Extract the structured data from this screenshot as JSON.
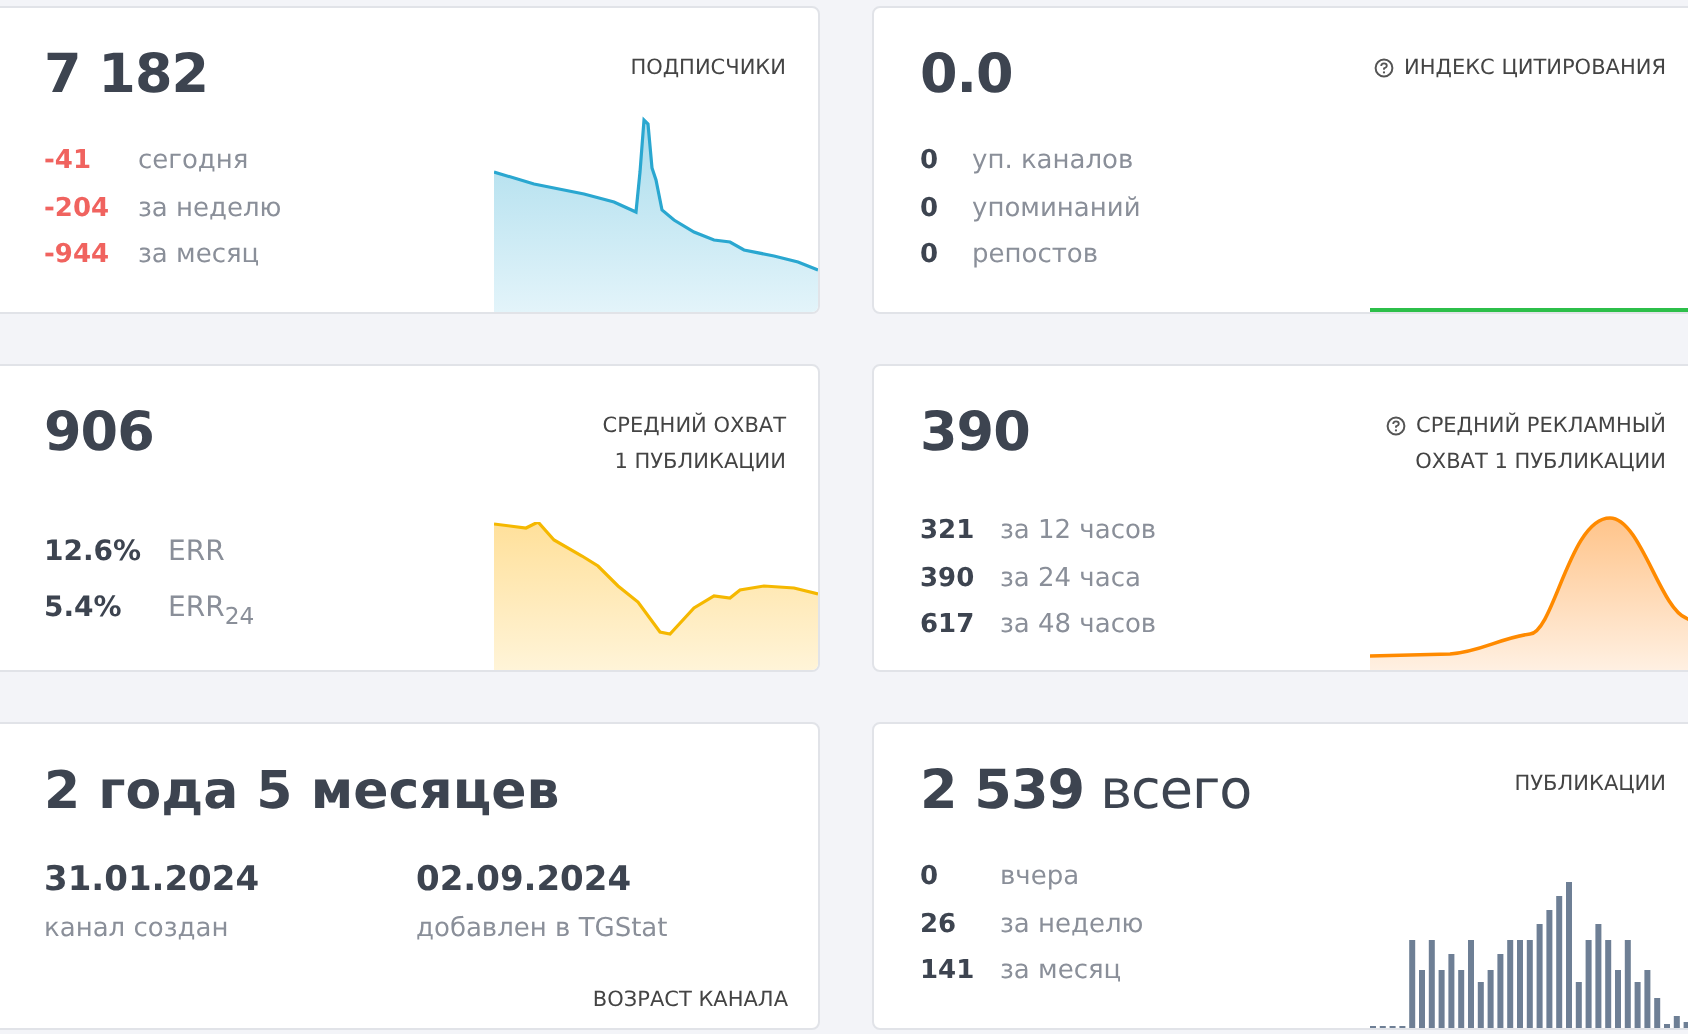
{
  "cards": [
    {
      "kind": "stats",
      "graph": {
        "kind": "subscribers"
      },
      "value": "7 182",
      "title": "ПОДПИСЧИКИ",
      "help": false,
      "stats": [
        {
          "value": "-41",
          "label": "сегодня",
          "negative": true
        },
        {
          "value": "-204",
          "label": "за неделю",
          "negative": true
        },
        {
          "value": "-944",
          "label": "за месяц",
          "negative": true
        }
      ]
    },
    {
      "kind": "stats",
      "graph": {
        "kind": "citation"
      },
      "value": "0.0",
      "title": "ИНДЕКС ЦИТИРОВАНИЯ",
      "help": true,
      "stats": [
        {
          "value": "0",
          "label": "уп. каналов",
          "negative": false
        },
        {
          "value": "0",
          "label": "упоминаний",
          "negative": false
        },
        {
          "value": "0",
          "label": "репостов",
          "negative": false
        }
      ]
    },
    {
      "kind": "stats",
      "graph": {
        "kind": "reach"
      },
      "value": "906",
      "title": "СРЕДНИЙ ОХВАТ\n1 ПУБЛИКАЦИИ",
      "help": false,
      "stats": [
        {
          "value": "12.6%",
          "label": "ERR",
          "negative": false
        },
        {
          "value": "5.4%",
          "label": "ERR$_{24}$",
          "negative": false
        }
      ]
    },
    {
      "kind": "stats",
      "graph": {
        "kind": "ad_reach"
      },
      "value": "390",
      "title": "СРЕДНИЙ РЕКЛАМНЫЙ\nОХВАТ 1 ПУБЛИКАЦИИ",
      "help": true,
      "stats": [
        {
          "value": "321",
          "label": "за 12 часов",
          "negative": false
        },
        {
          "value": "390",
          "label": "за 24 часа",
          "negative": false
        },
        {
          "value": "617",
          "label": "за 48 часов",
          "negative": false
        }
      ]
    },
    {
      "kind": "age",
      "value": "2 года 5 месяцев",
      "title": "ВОЗРАСТ КАНАЛА",
      "dates": [
        {
          "date": "31.01.2024",
          "label": "канал создан"
        },
        {
          "date": "02.09.2024",
          "label": "добавлен в TGStat"
        }
      ]
    },
    {
      "kind": "stats",
      "graph": {
        "kind": "posts"
      },
      "value": "**2 539** всего",
      "title": "ПУБЛИКАЦИИ",
      "help": false,
      "stats": [
        {
          "value": "0",
          "label": "вчера",
          "negative": false
        },
        {
          "value": "26",
          "label": "за неделю",
          "negative": false
        },
        {
          "value": "141",
          "label": "за месяц",
          "negative": false
        }
      ]
    }
  ]
}
